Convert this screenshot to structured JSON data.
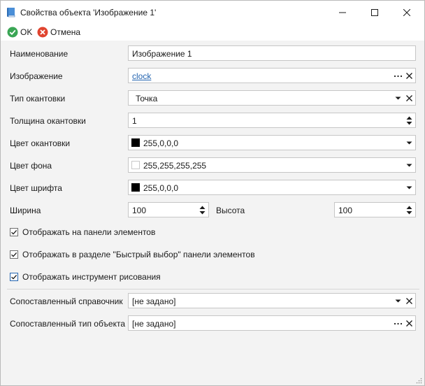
{
  "window": {
    "title": "Свойства объекта 'Изображение 1'",
    "controls": [
      "minimize-icon",
      "maximize-icon",
      "close-icon"
    ]
  },
  "toolbar": {
    "ok_label": "OK",
    "cancel_label": "Отмена"
  },
  "form": {
    "name": {
      "label": "Наименование",
      "value": "Изображение 1"
    },
    "image": {
      "label": "Изображение",
      "value": "clock"
    },
    "border_type": {
      "label": "Тип окантовки",
      "value": "Точка"
    },
    "border_width": {
      "label": "Толщина окантовки",
      "value": "1"
    },
    "border_color": {
      "label": "Цвет окантовки",
      "value": "255,0,0,0",
      "swatch": "#000000"
    },
    "background_color": {
      "label": "Цвет фона",
      "value": "255,255,255,255",
      "swatch": "#ffffff"
    },
    "font_color": {
      "label": "Цвет шрифта",
      "value": "255,0,0,0",
      "swatch": "#000000"
    },
    "width": {
      "label": "Ширина",
      "value": "100"
    },
    "height": {
      "label": "Высота",
      "value": "100"
    }
  },
  "checkboxes": [
    {
      "label": "Отображать на панели элементов",
      "checked": true
    },
    {
      "label": "Отображать в разделе \"Быстрый выбор\" панели элементов",
      "checked": true
    },
    {
      "label": "Отображать инструмент рисования",
      "checked": true
    }
  ],
  "mapping": {
    "directory": {
      "label": "Сопоставленный справочник",
      "value": "[не задано]"
    },
    "object_type": {
      "label": "Сопоставленный тип объекта",
      "value": "[не задано]"
    }
  },
  "colors": {
    "accent": "#2364b0",
    "ok_green": "#3aa655",
    "cancel_red": "#e0442f"
  }
}
